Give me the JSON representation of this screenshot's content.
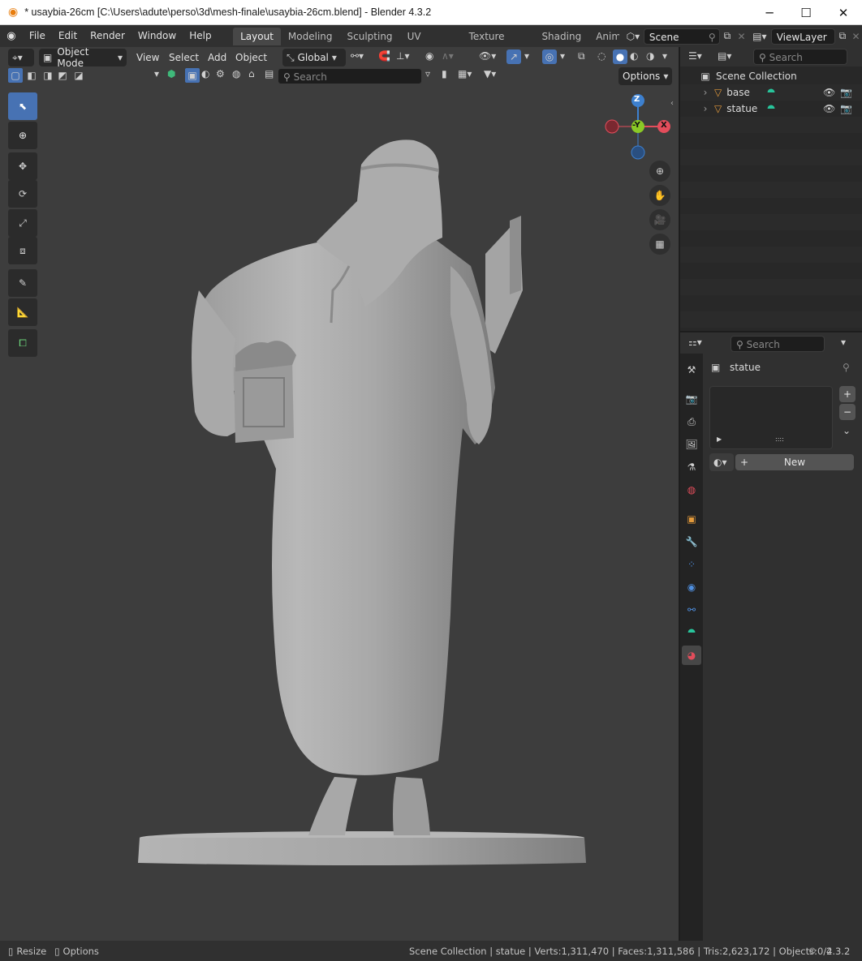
{
  "window": {
    "title": "* usaybia-26cm [C:\\Users\\adute\\perso\\3d\\mesh-finale\\usaybia-26cm.blend] - Blender 4.3.2",
    "minimize": "─",
    "maximize": "☐",
    "close": "✕"
  },
  "menu": {
    "items": [
      "File",
      "Edit",
      "Render",
      "Window",
      "Help"
    ],
    "workspaces": [
      "Layout",
      "Modeling",
      "Sculpting",
      "UV Editing",
      "Texture Paint",
      "Shading",
      "Anima"
    ],
    "active_workspace": "Layout",
    "scene": "Scene",
    "view_layer": "ViewLayer"
  },
  "viewport_header": {
    "mode": "Object Mode",
    "menus": [
      "View",
      "Select",
      "Add",
      "Object"
    ],
    "transform_orientation": "Global",
    "search_placeholder": "Search",
    "options": "Options"
  },
  "gizmo": {
    "z": "Z",
    "y": "-Y",
    "x": "X"
  },
  "outliner": {
    "search_placeholder": "Search",
    "collection": "Scene Collection",
    "objects": [
      {
        "name": "base"
      },
      {
        "name": "statue"
      }
    ]
  },
  "properties": {
    "search_placeholder": "Search",
    "object_name": "statue",
    "new_button": "New",
    "add": "+",
    "remove": "−"
  },
  "statusbar": {
    "left_resize": "Resize",
    "left_options": "Options",
    "stats": "Scene Collection | statue | Verts:1,311,470 | Faces:1,311,586 | Tris:2,623,172 | Objects:0/2",
    "version": "4.3.2"
  },
  "colors": {
    "accent": "#4772b3",
    "axis_x": "#e34d5b",
    "axis_y": "#8ac926",
    "axis_z": "#3d80cf",
    "mesh_icon": "#28c49b",
    "object_icon": "#e39a3b",
    "viewport_bg": "#3d3d3d"
  }
}
